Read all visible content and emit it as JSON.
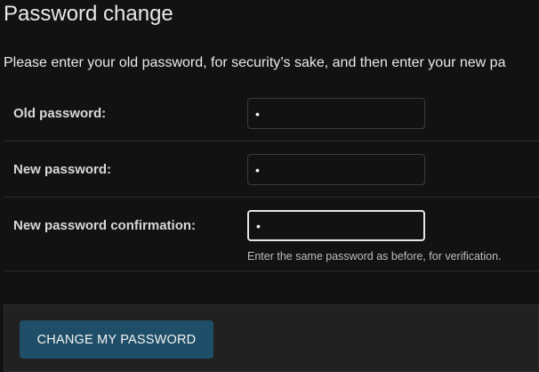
{
  "page": {
    "title": "Password change",
    "intro": "Please enter your old password, for security’s sake, and then enter your new pa"
  },
  "form": {
    "fields": [
      {
        "label": "Old password:",
        "value": "•",
        "type": "password"
      },
      {
        "label": "New password:",
        "value": "•",
        "type": "password"
      },
      {
        "label": "New password confirmation:",
        "value": "•",
        "type": "password",
        "focused": true,
        "help": "Enter the same password as before, for verification."
      }
    ],
    "submit_label": "CHANGE MY PASSWORD"
  },
  "colors": {
    "background": "#121212",
    "button": "#1f4f68",
    "submit_row": "#212121"
  }
}
